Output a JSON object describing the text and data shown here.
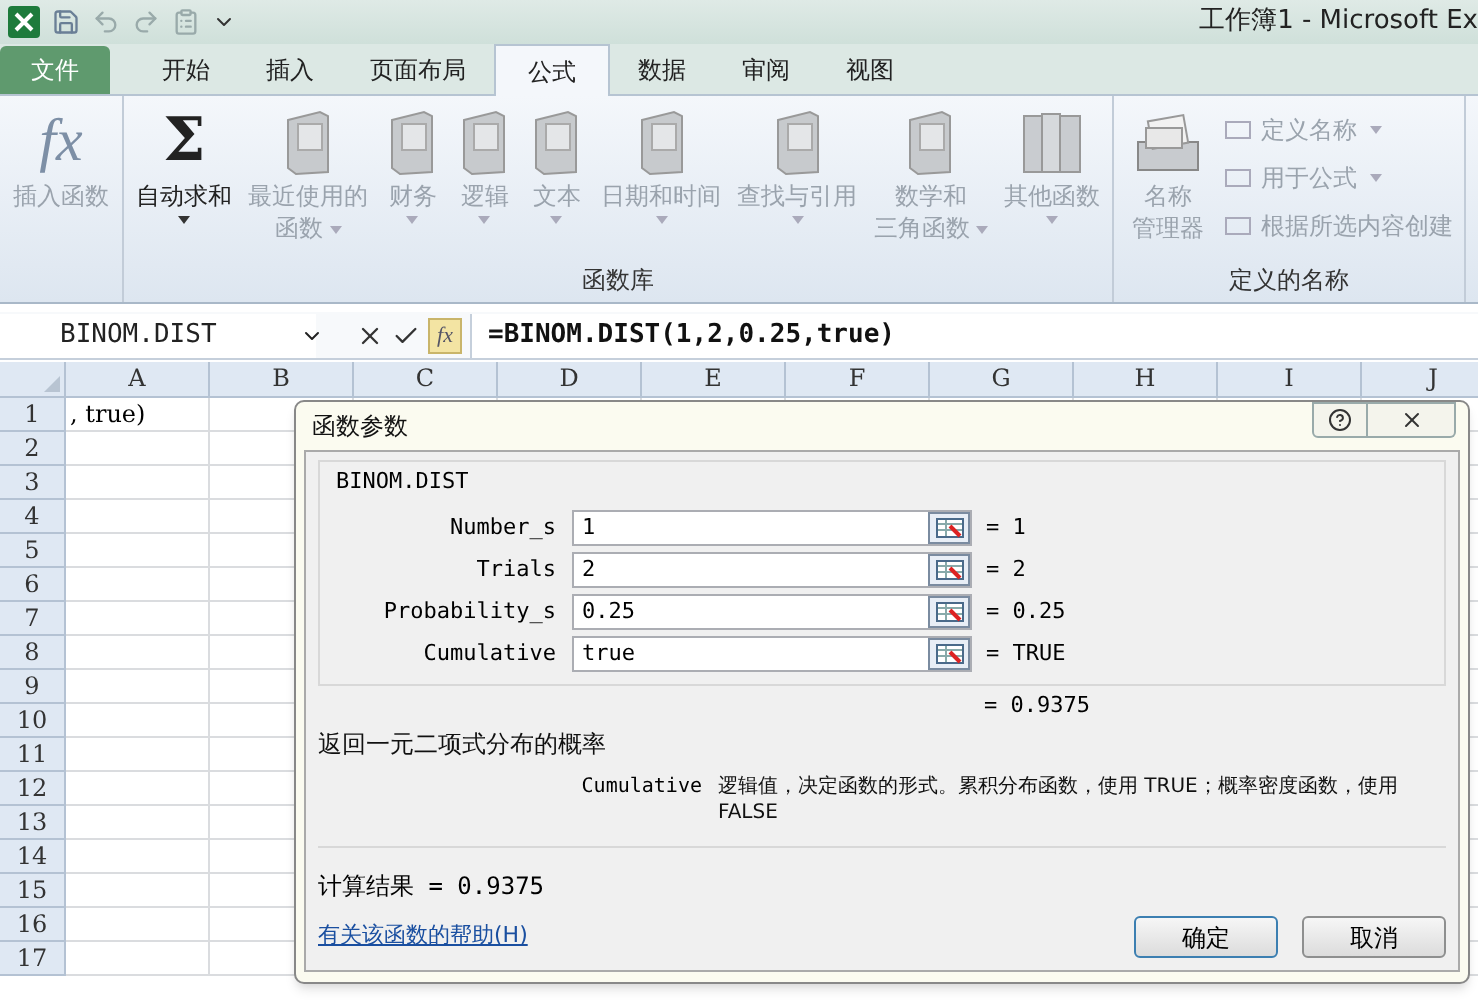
{
  "window": {
    "title": "工作簿1 - Microsoft Ex"
  },
  "ribbon_tabs": [
    {
      "label": "文件",
      "kind": "file",
      "selected": false
    },
    {
      "label": "开始",
      "kind": "tab",
      "selected": false
    },
    {
      "label": "插入",
      "kind": "tab",
      "selected": false
    },
    {
      "label": "页面布局",
      "kind": "tab",
      "selected": false
    },
    {
      "label": "公式",
      "kind": "tab",
      "selected": true
    },
    {
      "label": "数据",
      "kind": "tab",
      "selected": false
    },
    {
      "label": "审阅",
      "kind": "tab",
      "selected": false
    },
    {
      "label": "视图",
      "kind": "tab",
      "selected": false
    }
  ],
  "ribbon_groups": [
    {
      "buttons": [
        {
          "kind": "glyph",
          "glyph": "fx",
          "lines": [
            "插入函数"
          ],
          "disabled": true,
          "dropdown": false
        }
      ]
    },
    {
      "label": "函数库",
      "buttons": [
        {
          "kind": "glyph",
          "glyph": "Σ",
          "lines": [
            "自动求和"
          ],
          "disabled": false,
          "dropdown": true
        },
        {
          "kind": "book",
          "lines": [
            "最近使用的",
            "函数"
          ],
          "disabled": true,
          "dropdown": true
        },
        {
          "kind": "book",
          "lines": [
            "财务"
          ],
          "disabled": true,
          "dropdown": true
        },
        {
          "kind": "book",
          "lines": [
            "逻辑"
          ],
          "disabled": true,
          "dropdown": true
        },
        {
          "kind": "book",
          "lines": [
            "文本"
          ],
          "disabled": true,
          "dropdown": true
        },
        {
          "kind": "book",
          "lines": [
            "日期和时间"
          ],
          "disabled": true,
          "dropdown": true
        },
        {
          "kind": "book",
          "lines": [
            "查找与引用"
          ],
          "disabled": true,
          "dropdown": true
        },
        {
          "kind": "book",
          "lines": [
            "数学和",
            "三角函数"
          ],
          "disabled": true,
          "dropdown": true
        },
        {
          "kind": "books",
          "lines": [
            "其他函数"
          ],
          "disabled": true,
          "dropdown": true
        }
      ]
    },
    {
      "label": "定义的名称",
      "buttons": [
        {
          "kind": "cabinet",
          "lines": [
            "名称",
            "管理器"
          ],
          "disabled": true,
          "dropdown": false
        }
      ],
      "small_buttons": [
        {
          "label": "定义名称",
          "disabled": true,
          "dropdown": true
        },
        {
          "label": "用于公式",
          "disabled": true,
          "dropdown": true
        },
        {
          "label": "根据所选内容创建",
          "disabled": true,
          "dropdown": false
        }
      ]
    }
  ],
  "formula_bar": {
    "name_box": "BINOM.DIST",
    "fx": "fx",
    "formula": "=BINOM.DIST(1,2,0.25,true)"
  },
  "sheet": {
    "columns": [
      "A",
      "B",
      "C",
      "D",
      "E",
      "F",
      "G",
      "H",
      "I",
      "J"
    ],
    "rows": [
      {
        "header": "1",
        "cells": [
          ", true)"
        ]
      },
      {
        "header": "2",
        "cells": []
      },
      {
        "header": "3",
        "cells": []
      },
      {
        "header": "4",
        "cells": []
      },
      {
        "header": "5",
        "cells": []
      },
      {
        "header": "6",
        "cells": []
      },
      {
        "header": "7",
        "cells": []
      },
      {
        "header": "8",
        "cells": []
      },
      {
        "header": "9",
        "cells": []
      },
      {
        "header": "10",
        "cells": []
      },
      {
        "header": "11",
        "cells": []
      },
      {
        "header": "12",
        "cells": []
      },
      {
        "header": "13",
        "cells": []
      },
      {
        "header": "14",
        "cells": []
      },
      {
        "header": "15",
        "cells": []
      },
      {
        "header": "16",
        "cells": []
      },
      {
        "header": "17",
        "cells": []
      }
    ]
  },
  "dialog": {
    "title": "函数参数",
    "function_name": "BINOM.DIST",
    "arguments": [
      {
        "label": "Number_s",
        "value": "1",
        "result": "= 1"
      },
      {
        "label": "Trials",
        "value": "2",
        "result": "= 2"
      },
      {
        "label": "Probability_s",
        "value": "0.25",
        "result": "= 0.25"
      },
      {
        "label": "Cumulative",
        "value": "true",
        "result": "= TRUE"
      }
    ],
    "formula_result": "= 0.9375",
    "description": "返回一元二项式分布的概率",
    "parameter_help": {
      "name": "Cumulative",
      "text": "逻辑值，决定函数的形式。累积分布函数，使用 TRUE；概率密度函数，使用 FALSE"
    },
    "computed": "计算结果 = 0.9375",
    "help_link": "有关该函数的帮助(H)",
    "buttons": [
      "确定",
      "取消"
    ]
  }
}
